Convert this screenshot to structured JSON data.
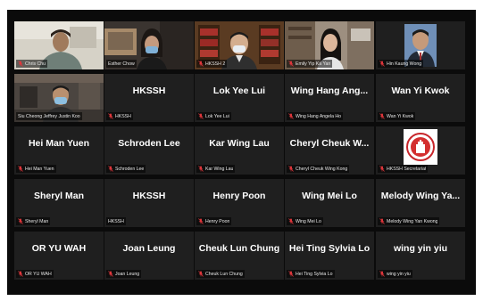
{
  "rows": [
    [
      {
        "caption": "Chris Chu",
        "display": "",
        "muted": true,
        "video": "chris"
      },
      {
        "caption": "Esther Chow",
        "display": "",
        "muted": false,
        "video": "esther"
      },
      {
        "caption": "HKSSH 2",
        "display": "",
        "muted": true,
        "video": "hkssh2",
        "active": true
      },
      {
        "caption": "Emily Yip Ka Yan",
        "display": "",
        "muted": true,
        "video": "emily"
      },
      {
        "caption": "Hin Kaung Wong",
        "display": "",
        "muted": true,
        "video": "hin"
      }
    ],
    [
      {
        "caption": "Siu Cheong Jeffrey Justin Koo",
        "display": "",
        "muted": false,
        "video": "siu"
      },
      {
        "caption": "HKSSH",
        "display": "HKSSH",
        "muted": true
      },
      {
        "caption": "Lok Yee Lui",
        "display": "Lok Yee Lui",
        "muted": true
      },
      {
        "caption": "Wing Hang Angela Ho",
        "display": "Wing Hang Ang...",
        "muted": true
      },
      {
        "caption": "Wan Yi Kwok",
        "display": "Wan Yi Kwok",
        "muted": true
      }
    ],
    [
      {
        "caption": "Hei Man Yuen",
        "display": "Hei Man Yuen",
        "muted": true
      },
      {
        "caption": "Schroden Lee",
        "display": "Schroden Lee",
        "muted": true
      },
      {
        "caption": "Kar Wing Lau",
        "display": "Kar Wing Lau",
        "muted": true
      },
      {
        "caption": "Cheryl Cheuk Wing Kong",
        "display": "Cheryl Cheuk W...",
        "muted": true
      },
      {
        "caption": "HKSSH Secretariat",
        "display": "",
        "muted": true,
        "video": "logo"
      }
    ],
    [
      {
        "caption": "Sheryl Man",
        "display": "Sheryl Man",
        "muted": true
      },
      {
        "caption": "HKSSH",
        "display": "HKSSH",
        "muted": false
      },
      {
        "caption": "Henry Poon",
        "display": "Henry Poon",
        "muted": true
      },
      {
        "caption": "Wing Mei Lo",
        "display": "Wing Mei Lo",
        "muted": true
      },
      {
        "caption": "Melody Wing Yan Kwong",
        "display": "Melody Wing Ya...",
        "muted": true
      }
    ],
    [
      {
        "caption": "OR YU WAH",
        "display": "OR YU WAH",
        "muted": true
      },
      {
        "caption": "Joan Leung",
        "display": "Joan Leung",
        "muted": true
      },
      {
        "caption": "Cheuk Lun Chung",
        "display": "Cheuk Lun Chung",
        "muted": true
      },
      {
        "caption": "Hei Ting Sylvia Lo",
        "display": "Hei Ting Sylvia Lo",
        "muted": true
      },
      {
        "caption": "wing yin yiu",
        "display": "wing yin yiu",
        "muted": true
      }
    ]
  ],
  "colors": {
    "tile": "#1f1f1f",
    "active_border": "#c8e04a",
    "mic_muted": "#e0363b"
  }
}
